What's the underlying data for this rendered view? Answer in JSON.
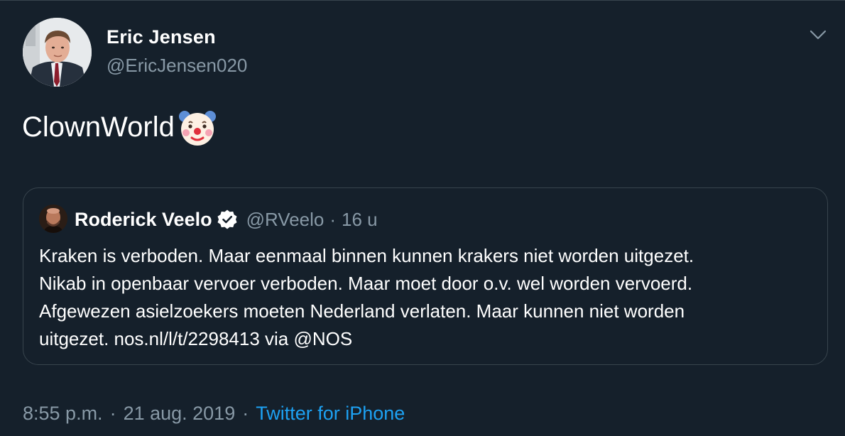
{
  "author": {
    "display_name": "Eric Jensen",
    "handle": "@EricJensen020"
  },
  "icons": {
    "menu": "chevron-down-icon",
    "emoji": "clown-face-icon",
    "verified": "verified-badge-icon"
  },
  "tweet": {
    "text": "ClownWorld"
  },
  "quoted": {
    "display_name": "Roderick Veelo",
    "handle": "@RVeelo",
    "dot": "·",
    "time": "16 u",
    "lines": [
      "Kraken is verboden. Maar eenmaal binnen kunnen krakers niet worden uitgezet.",
      "Nikab in openbaar vervoer verboden. Maar moet door o.v. wel worden vervoerd.",
      "Afgewezen asielzoekers moeten Nederland verlaten. Maar kunnen niet worden",
      "uitgezet. nos.nl/l/t/2298413 via @NOS"
    ]
  },
  "meta": {
    "time": "8:55 p.m.",
    "sep": "·",
    "date": "21 aug. 2019",
    "source": "Twitter for iPhone"
  },
  "colors": {
    "background": "#15202b",
    "border": "#38444d",
    "muted": "#8899a6",
    "link": "#1da1f2"
  }
}
